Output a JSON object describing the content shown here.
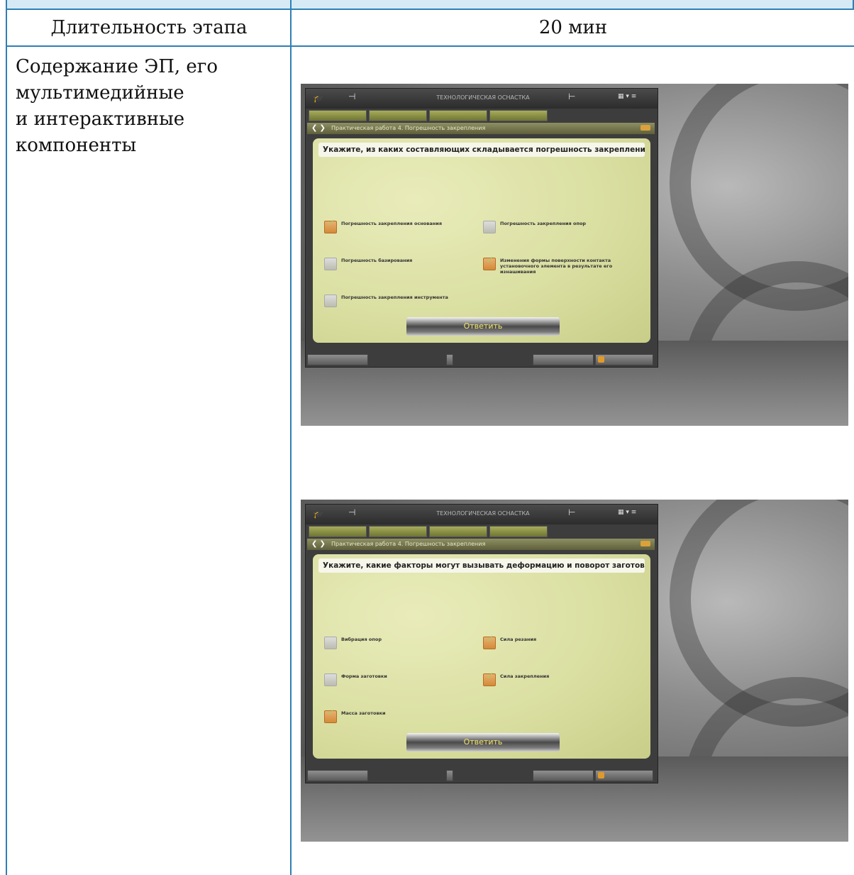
{
  "table": {
    "duration_label": "Длительность этапа",
    "duration_value": "20 мин",
    "content_label_lines": [
      "Содержание ЭП, его",
      "мультимедийные",
      "и интерактивные",
      "компоненты"
    ]
  },
  "screens": [
    {
      "app_title": "ТЕХНОЛОГИЧЕСКАЯ ОСНАСТКА",
      "breadcrumb": "Практическая работа 4. Погрешность закрепления",
      "question": "Укажите, из каких составляющих складывается погрешность закрепления",
      "options": [
        {
          "label": "Погрешность закрепления основания",
          "checked": true
        },
        {
          "label": "Погрешность закрепления опор",
          "checked": false
        },
        {
          "label": "Погрешность базирования",
          "checked": false
        },
        {
          "label": "Изменения формы поверхности контакта установочного элемента в результате его изнашивания",
          "checked": true
        },
        {
          "label": "Погрешность закрепления инструмента",
          "checked": false
        }
      ],
      "answer_button": "Ответить"
    },
    {
      "app_title": "ТЕХНОЛОГИЧЕСКАЯ ОСНАСТКА",
      "breadcrumb": "Практическая работа 4. Погрешность закрепления",
      "question": "Укажите, какие факторы могут вызывать деформацию и поворот заготовки",
      "options": [
        {
          "label": "Вибрация опор",
          "checked": false
        },
        {
          "label": "Сила резания",
          "checked": true
        },
        {
          "label": "Форма заготовки",
          "checked": false
        },
        {
          "label": "Сила закрепления",
          "checked": true
        },
        {
          "label": "Масса заготовки",
          "checked": true
        }
      ],
      "answer_button": "Ответить"
    }
  ]
}
